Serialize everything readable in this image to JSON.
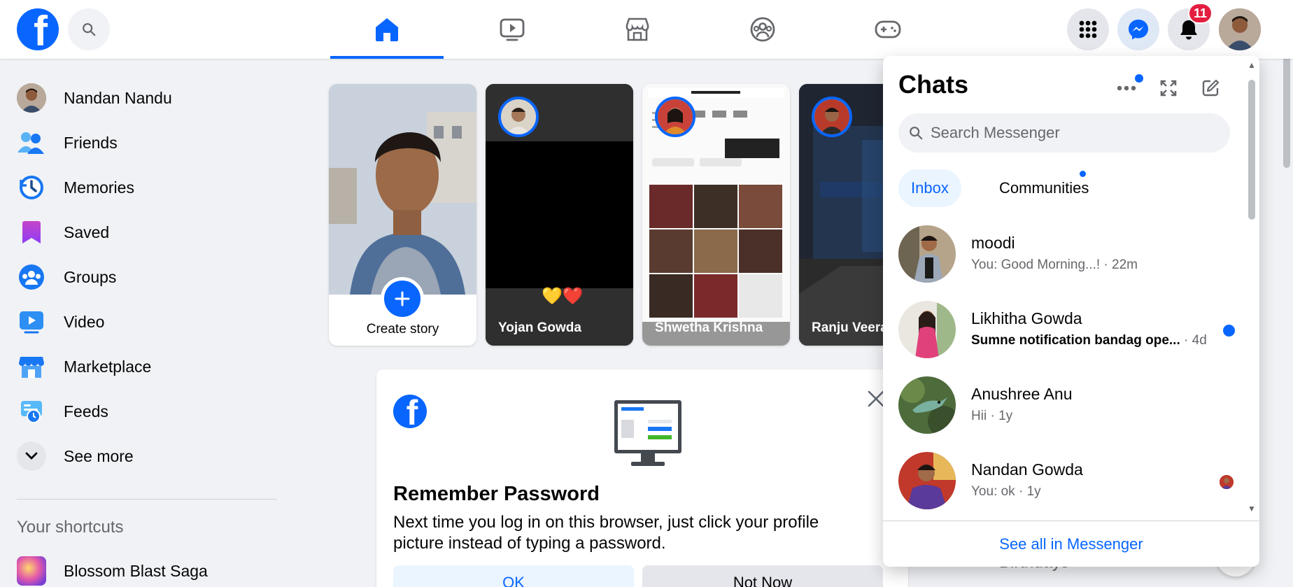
{
  "nav": {
    "tabs": [
      {
        "name": "home",
        "active": true
      },
      {
        "name": "watch",
        "active": false
      },
      {
        "name": "marketplace",
        "active": false
      },
      {
        "name": "groups",
        "active": false
      },
      {
        "name": "gaming",
        "active": false
      }
    ],
    "notification_badge": "11",
    "icons": [
      "search-icon",
      "home-icon",
      "video-icon",
      "marketplace-icon",
      "groups-icon",
      "gaming-icon",
      "menu-icon",
      "messenger-icon",
      "bell-icon"
    ]
  },
  "sidebar": {
    "items": [
      {
        "label": "Nandan Nandu",
        "icon": "profile-avatar"
      },
      {
        "label": "Friends",
        "icon": "friends-icon"
      },
      {
        "label": "Memories",
        "icon": "memories-icon"
      },
      {
        "label": "Saved",
        "icon": "saved-icon"
      },
      {
        "label": "Groups",
        "icon": "groups-icon"
      },
      {
        "label": "Video",
        "icon": "video-icon"
      },
      {
        "label": "Marketplace",
        "icon": "marketplace-icon"
      },
      {
        "label": "Feeds",
        "icon": "feeds-icon"
      },
      {
        "label": "See more",
        "icon": "chevron-down-icon"
      }
    ],
    "shortcuts_title": "Your shortcuts",
    "shortcuts": [
      {
        "label": "Blossom Blast Saga"
      }
    ]
  },
  "stories": {
    "create_label": "Create story",
    "items": [
      {
        "name": "Yojan Gowda"
      },
      {
        "name": "Shwetha Krishna"
      },
      {
        "name": "Ranju Veera"
      }
    ]
  },
  "password_card": {
    "title": "Remember Password",
    "text": "Next time you log in on this browser, just click your profile picture instead of typing a password.",
    "ok_label": "OK",
    "not_now_label": "Not Now"
  },
  "right_column": {
    "birthdays_label": "Birthdays"
  },
  "chats": {
    "title": "Chats",
    "search_placeholder": "Search Messenger",
    "tabs": [
      {
        "label": "Inbox",
        "active": true
      },
      {
        "label": "Communities",
        "active": false
      }
    ],
    "conversations": [
      {
        "name": "moodi",
        "preview": "You: Good Morning...!",
        "time": "22m",
        "unread": false
      },
      {
        "name": "Likhitha Gowda",
        "preview": "Sumne notification bandag ope...",
        "time": "4d",
        "unread": true
      },
      {
        "name": "Anushree Anu",
        "preview": "Hii",
        "time": "1y",
        "unread": false
      },
      {
        "name": "Nandan Gowda",
        "preview": "You: ok",
        "time": "1y",
        "unread": false
      }
    ],
    "footer_link": "See all in Messenger"
  },
  "colors": {
    "brand": "#0866ff",
    "badge": "#e41e3f",
    "background": "#f0f2f5"
  }
}
